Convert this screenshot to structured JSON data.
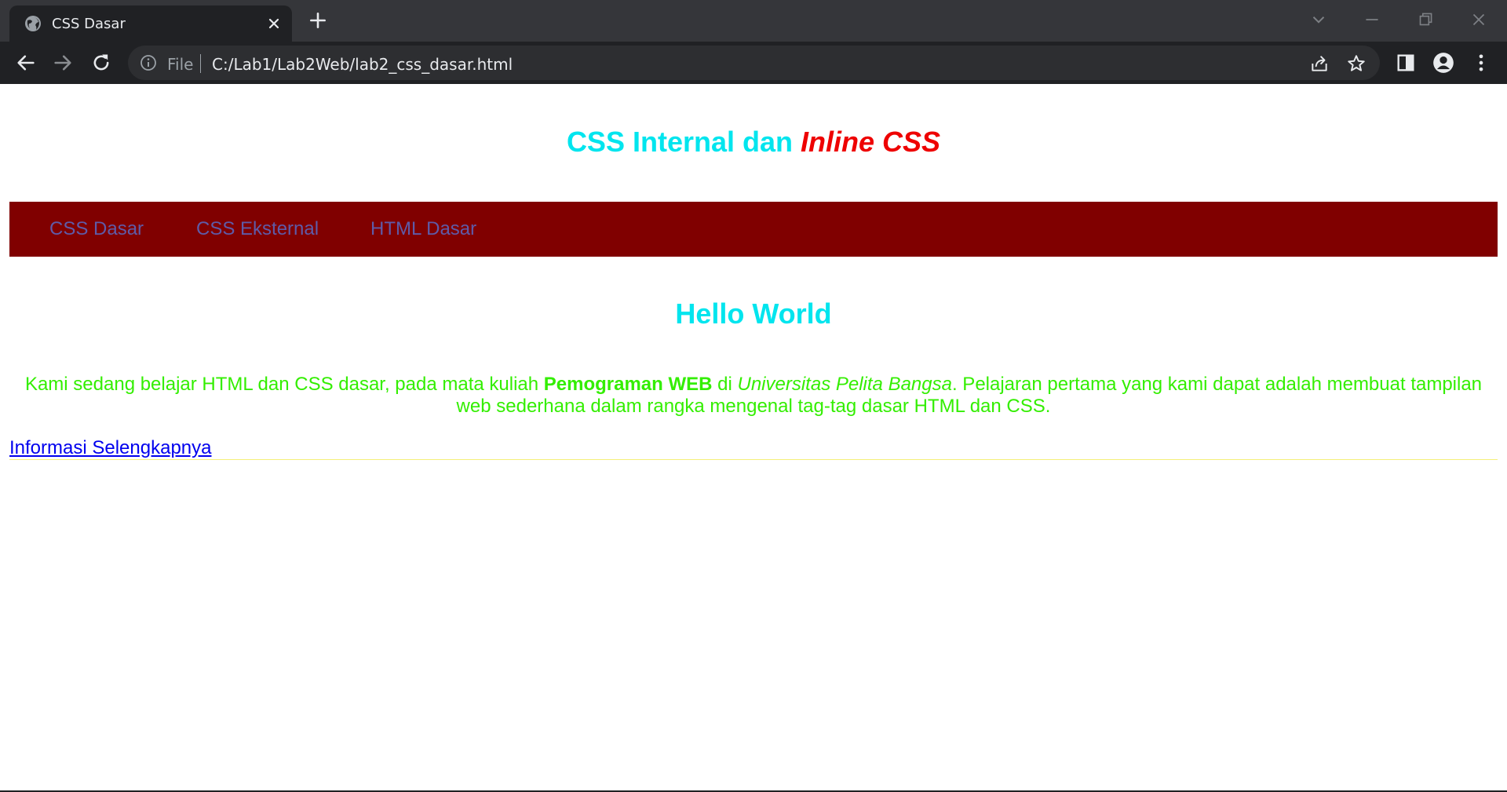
{
  "browser": {
    "tab": {
      "title": "CSS Dasar"
    },
    "address": {
      "scheme_label": "File",
      "url": "C:/Lab1/Lab2Web/lab2_css_dasar.html"
    }
  },
  "page": {
    "title_plain": "CSS Internal dan",
    "title_emph": "Inline CSS",
    "menu": [
      "CSS Dasar",
      "CSS Eksternal",
      "HTML Dasar"
    ],
    "heading": "Hello World",
    "paragraph": {
      "part1": "Kami sedang belajar HTML dan CSS dasar, pada mata kuliah ",
      "bold": "Pemograman WEB",
      "part2": " di ",
      "italic": "Universitas Pelita Bangsa",
      "part3": ". Pelajaran pertama yang kami dapat adalah membuat tampilan web sederhana dalam rangka mengenal tag-tag dasar HTML dan CSS."
    },
    "link": "Informasi Selengkapnya"
  },
  "colors": {
    "tabbar": "#35363a",
    "toolbar": "#202124",
    "title": "#00e5ee",
    "title_emph": "#ee0000",
    "menubar": "#800000",
    "menu_text": "#5e5ba8",
    "paragraph": "#33ee00",
    "link": "#0000ee",
    "rule": "#f5f07a"
  }
}
